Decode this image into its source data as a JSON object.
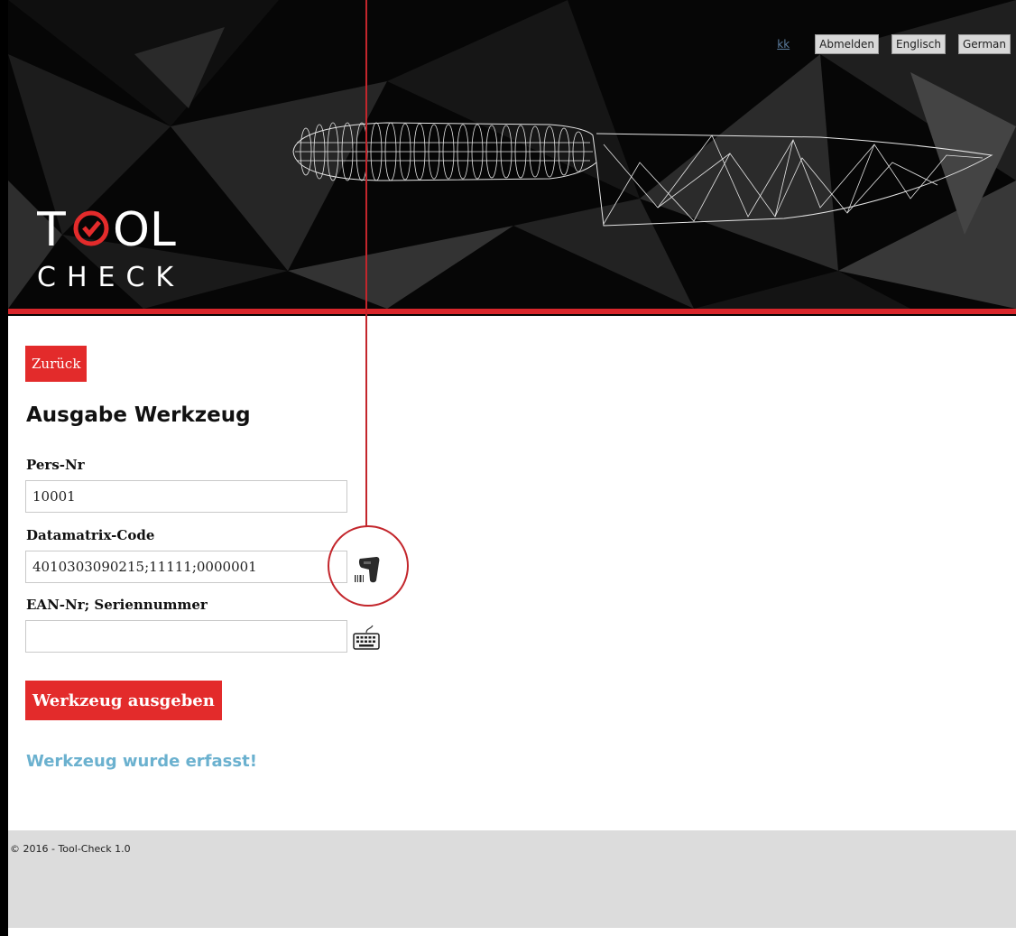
{
  "header": {
    "user": "kk",
    "buttons": {
      "logout": "Abmelden",
      "english": "Englisch",
      "german": "German"
    },
    "logo": {
      "line1": "TOOL",
      "line2": "CHECK"
    }
  },
  "back_label": "Zurück",
  "page_title": "Ausgabe Werkzeug",
  "form": {
    "pers_nr": {
      "label": "Pers-Nr",
      "value": "10001"
    },
    "datamatrix": {
      "label": "Datamatrix-Code",
      "value": "4010303090215;11111;0000001"
    },
    "ean": {
      "label": "EAN-Nr; Seriennummer",
      "value": ""
    }
  },
  "icons": {
    "scanner": "barcode-scanner-icon",
    "keyboard": "keyboard-icon"
  },
  "submit_label": "Werkzeug ausgeben",
  "success_message": "Werkzeug wurde erfasst!",
  "footer": "© 2016 - Tool-Check 1.0",
  "colors": {
    "brand_red": "#e32b2b",
    "header_bg": "#050505",
    "success": "#6bb1cf",
    "footer_bg": "#dcdcdc"
  }
}
